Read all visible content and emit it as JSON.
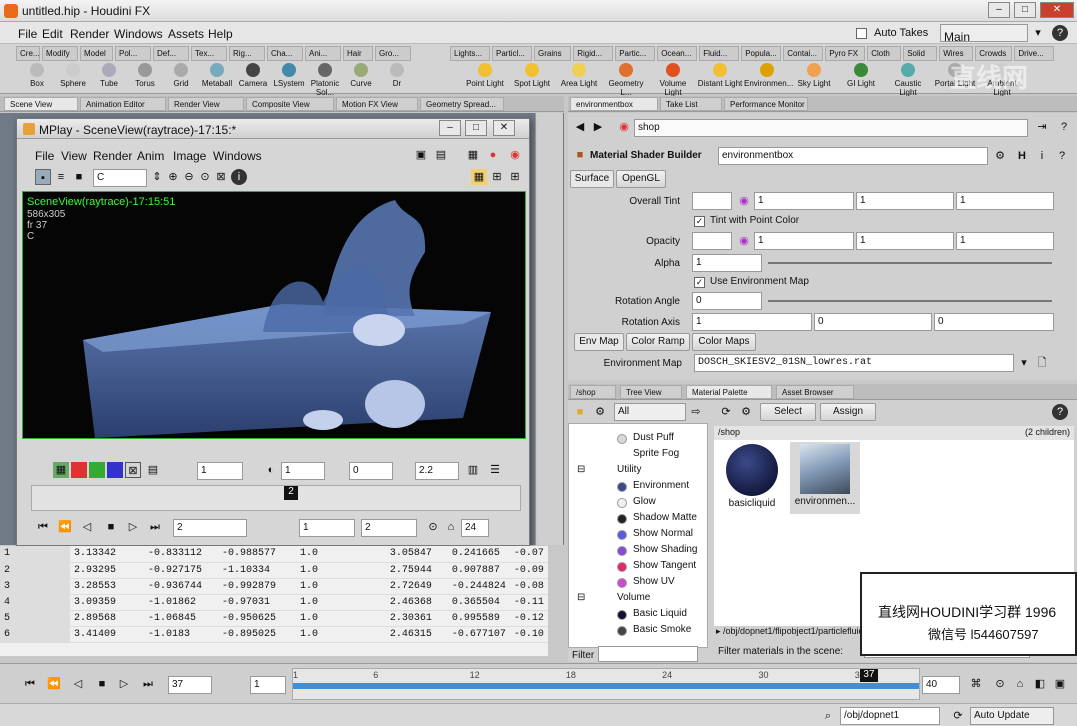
{
  "window": {
    "title": "untitled.hip - Houdini FX"
  },
  "menu": [
    "File",
    "Edit",
    "Render",
    "Windows",
    "Assets",
    "Help"
  ],
  "auto_takes": "Auto Takes",
  "desktop": "Main",
  "shelf_left_tabs": [
    "Cre...",
    "Modify",
    "Model",
    "Pol...",
    "Def...",
    "Tex...",
    "Rig...",
    "Cha...",
    "Ani...",
    "Hair",
    "Gro..."
  ],
  "shelf_left_tools": [
    "Box",
    "Sphere",
    "Tube",
    "Torus",
    "Grid",
    "Metaball",
    "Camera",
    "LSystem",
    "Platonic Sol...",
    "Curve",
    "Dr"
  ],
  "shelf_right_tabs": [
    "Lights...",
    "Particl...",
    "Grains",
    "Rigid...",
    "Partic...",
    "Ocean...",
    "Fluid...",
    "Popula...",
    "Contai...",
    "Pyro FX",
    "Cloth",
    "Solid",
    "Wires",
    "Crowds",
    "Drive..."
  ],
  "shelf_right_tools": [
    "Point Light",
    "Spot Light",
    "Area Light",
    "Geometry L...",
    "Volume Light",
    "Distant Light",
    "Environmen...",
    "Sky Light",
    "GI Light",
    "Caustic Light",
    "Portal Light",
    "Ambient Light"
  ],
  "left_pane_tabs": [
    "Scene View",
    "Animation Editor",
    "Render View",
    "Composite View",
    "Motion FX View",
    "Geometry Spread..."
  ],
  "mplay": {
    "title": "MPlay - SceneView(raytrace)-17:15:*",
    "menu": [
      "File",
      "View",
      "Render",
      "Anim",
      "Image",
      "Windows"
    ],
    "channel": "C",
    "overlay": [
      "SceneView(raytrace)-17:15:51",
      "586x305",
      "fr 37",
      "C"
    ],
    "gamma": "1",
    "exposure": "1",
    "v3": "0",
    "v4": "2.2",
    "frame_marker": "2",
    "frame_value": "2",
    "start": "1",
    "end": "2",
    "fps": "24"
  },
  "spreadsheet": {
    "rows": [
      [
        "1",
        "3.13342",
        "-0.833112",
        "-0.988577",
        "1.0",
        "3.05847",
        "0.241665",
        "-0.07"
      ],
      [
        "2",
        "2.93295",
        "-0.927175",
        "-1.10334",
        "1.0",
        "2.75944",
        "0.907887",
        "-0.09"
      ],
      [
        "3",
        "3.28553",
        "-0.936744",
        "-0.992879",
        "1.0",
        "2.72649",
        "-0.244824",
        "-0.08"
      ],
      [
        "4",
        "3.09359",
        "-1.01862",
        "-0.97031",
        "1.0",
        "2.46368",
        "0.365504",
        "-0.11"
      ],
      [
        "5",
        "2.89568",
        "-1.06845",
        "-0.950625",
        "1.0",
        "2.30361",
        "0.995589",
        "-0.12"
      ],
      [
        "6",
        "3.41409",
        "-1.0183",
        "-0.895025",
        "1.0",
        "2.46315",
        "-0.677107",
        "-0.10"
      ]
    ]
  },
  "right_top_tabs": [
    "environmentbox",
    "Take List",
    "Performance Monitor"
  ],
  "path": "shop",
  "builder": {
    "type": "Material Shader Builder",
    "name": "environmentbox"
  },
  "param_tabs": [
    "Surface",
    "OpenGL"
  ],
  "params": {
    "overall_tint_label": "Overall Tint",
    "overall_tint": [
      "1",
      "1",
      "1"
    ],
    "tint_point_color": "Tint with Point Color",
    "opacity_label": "Opacity",
    "opacity": [
      "1",
      "1",
      "1"
    ],
    "alpha_label": "Alpha",
    "alpha": "1",
    "use_env_map": "Use Environment Map",
    "rotation_angle_label": "Rotation Angle",
    "rotation_angle": "0",
    "rotation_axis_label": "Rotation Axis",
    "rotation_axis": [
      "1",
      "0",
      "0"
    ],
    "sub_tabs": [
      "Env Map",
      "Color Ramp",
      "Color Maps"
    ],
    "env_map_label": "Environment Map",
    "env_map": "DOSCH_SKIESV2_01SN_lowres.rat"
  },
  "bottom_right_tabs": [
    "/shop",
    "Tree View",
    "Material Palette",
    "Asset Browser"
  ],
  "palette": {
    "filter_all": "All",
    "select": "Select",
    "assign": "Assign",
    "shop_path": "/shop",
    "children": "(2 children)",
    "materials": [
      "basicliquid",
      "environmen..."
    ],
    "tree": [
      {
        "label": "Dust Puff",
        "indent": 2,
        "color": "#d8d8d8"
      },
      {
        "label": "Sprite Fog",
        "indent": 2,
        "color": ""
      },
      {
        "label": "Utility",
        "indent": 1,
        "color": ""
      },
      {
        "label": "Environment",
        "indent": 2,
        "color": "#3b4a8c"
      },
      {
        "label": "Glow",
        "indent": 2,
        "color": "#f0f0f0"
      },
      {
        "label": "Shadow Matte",
        "indent": 2,
        "color": "#222222"
      },
      {
        "label": "Show Normal",
        "indent": 2,
        "color": "#5a5ae0"
      },
      {
        "label": "Show Shading",
        "indent": 2,
        "color": "#8a4ad8"
      },
      {
        "label": "Show Tangent",
        "indent": 2,
        "color": "#e02a6a"
      },
      {
        "label": "Show UV",
        "indent": 2,
        "color": "#d04ad0"
      },
      {
        "label": "Volume",
        "indent": 1,
        "color": ""
      },
      {
        "label": "Basic Liquid",
        "indent": 2,
        "color": "#101030"
      },
      {
        "label": "Basic Smoke",
        "indent": 2,
        "color": "#444444"
      }
    ],
    "bottom_path": "▸ /obj/dopnet1/flipobject1/particlefluidobject/...uid.../s",
    "filter_label": "Filter",
    "filter_scene": "Filter materials in the scene:"
  },
  "watermark": {
    "line1": "直线网HOUDINI学习群 1996",
    "line2": "微信号 l544607597",
    "logo": "直线网"
  },
  "timeline": {
    "frame": "37",
    "step": "1",
    "ticks": [
      "1",
      "6",
      "12",
      "18",
      "24",
      "30",
      "36"
    ],
    "marker": "37",
    "end": "40",
    "current_fraction": 0.92
  },
  "status": {
    "path": "/obj/dopnet1",
    "update": "Auto Update"
  }
}
